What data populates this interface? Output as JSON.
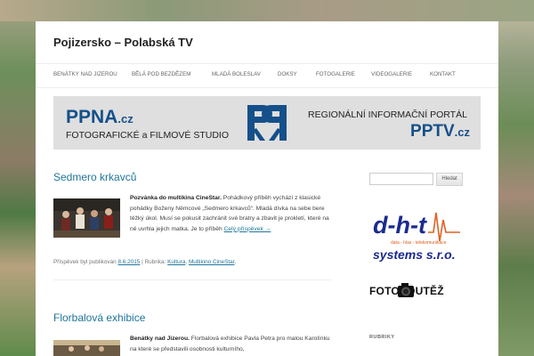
{
  "site": {
    "title": "Pojizersko – Polabská TV"
  },
  "nav": [
    "BENÁTKY NAD JIZEROU",
    "BĚLÁ POD BEZDĚZEM",
    "MLADÁ BOLESLAV",
    "DOKSY",
    "FOTOGALERIE",
    "VIDEOGALERIE",
    "KONTAKT"
  ],
  "banner": {
    "left_brand": "PPNA",
    "left_tld": ".cz",
    "left_subtitle": "FOTOGRAFICKÉ a FILMOVÉ STUDIO",
    "right_title": "REGIONÁLNÍ INFORMAČNÍ PORTÁL",
    "right_brand": "PPTV",
    "right_tld": ".cz",
    "accent": "#15508a"
  },
  "posts": [
    {
      "title": "Sedmero krkavců",
      "lead": "Pozvánka do multikina CineStar.",
      "body": " Pohádkový příběh vychází z klasické pohádky Boženy Němcové „Sedmero krkavců“. Mladá dívka na sebe bere těžký úkol. Musí se pokusit zachránit své bratry a zbavit je prokletí, které na ně uvrhla jejich matka. Je to příběh ",
      "more": "Celý příspěvek →",
      "meta_prefix": "Příspěvek byl publikován ",
      "date": "8.6.2015",
      "meta_mid": " | Rubrika: ",
      "category1": "Kultura",
      "category_sep": ", ",
      "category2": "Multikino CineStar",
      "meta_end": "."
    },
    {
      "title": "Florbalová exhibice",
      "lead": "Benátky nad Jizerou.",
      "body": " Florbalová exhibice Pavla Petra pro malou Karolínku na které se představili osobnosti kulturního,"
    }
  ],
  "sidebar": {
    "search_button": "Hledat",
    "dht_logo_main": "d-h-t",
    "dht_logo_tagline": "data - hlas - telekomunikace",
    "dht_logo_company": "systems s.r.o.",
    "foto_logo_text": "FOTOSOUTĚŽ",
    "rubriky_heading": "RUBRIKY"
  },
  "colors": {
    "link": "#21759b",
    "page_bg": "#ffffff",
    "banner_bg": "#dfdfdf"
  }
}
